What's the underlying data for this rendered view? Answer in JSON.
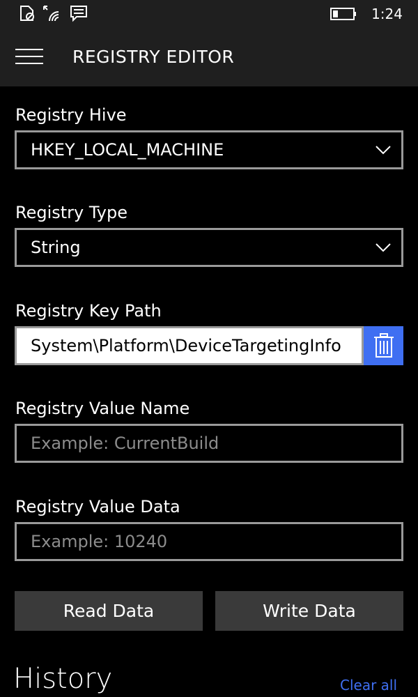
{
  "status_bar": {
    "time": "1:24",
    "icons": [
      "sim-no-signal-icon",
      "wifi-icon",
      "message-icon",
      "battery-icon"
    ]
  },
  "app_bar": {
    "title": "REGISTRY EDITOR",
    "menu_icon": "hamburger-menu-icon"
  },
  "form": {
    "hive": {
      "label": "Registry Hive",
      "value": "HKEY_LOCAL_MACHINE"
    },
    "type": {
      "label": "Registry Type",
      "value": "String"
    },
    "key_path": {
      "label": "Registry Key Path",
      "value": "System\\Platform\\DeviceTargetingInfo",
      "clear_icon": "trash-icon"
    },
    "value_name": {
      "label": "Registry Value Name",
      "placeholder": "Example: CurrentBuild"
    },
    "value_data": {
      "label": "Registry Value Data",
      "placeholder": "Example: 10240"
    }
  },
  "actions": {
    "read_label": "Read Data",
    "write_label": "Write Data"
  },
  "history": {
    "title": "History",
    "clear_label": "Clear all"
  },
  "colors": {
    "accent": "#3f6ff2",
    "background": "#000000",
    "bar": "#1f1f1f",
    "button": "#3a3a3a",
    "border": "#9a9a9a"
  }
}
